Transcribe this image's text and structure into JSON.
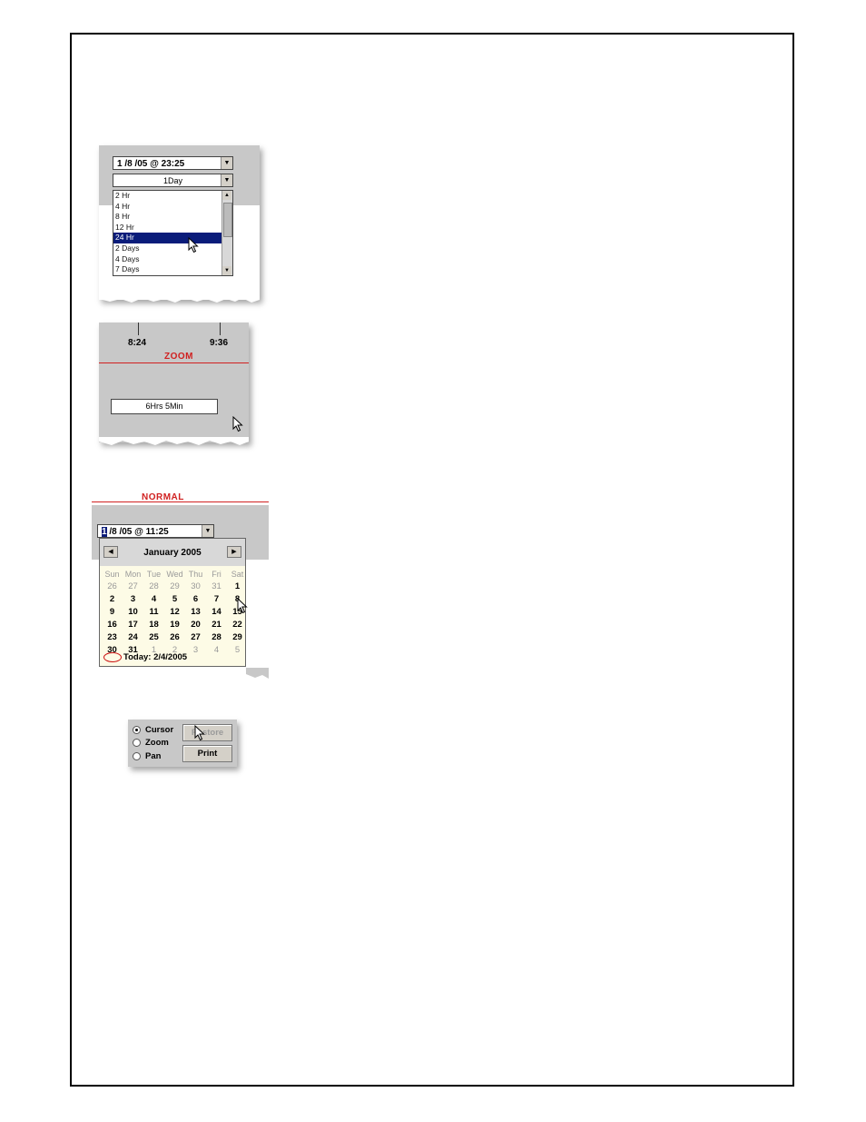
{
  "duration_picker": {
    "date_time": "1 /8 /05 @ 23:25",
    "period": "1Day",
    "options": [
      "2 Hr",
      "4 Hr",
      "8 Hr",
      "12 Hr",
      "24 Hr",
      "2 Days",
      "4 Days",
      "7 Days"
    ],
    "selected_option": "24 Hr"
  },
  "zoom_panel": {
    "tick_start": "8:24",
    "tick_end": "9:36",
    "section_label": "ZOOM",
    "span": "6Hrs 5Min"
  },
  "calendar_panel": {
    "section_label": "NORMAL",
    "date_time_cursor": "1",
    "date_time_rest": " /8 /05 @ 11:25",
    "month": "January 2005",
    "prev_icon": "chevron-left-icon",
    "next_icon": "chevron-right-icon",
    "weekdays": [
      "Sun",
      "Mon",
      "Tue",
      "Wed",
      "Thu",
      "Fri",
      "Sat"
    ],
    "weeks": [
      [
        "26",
        "27",
        "28",
        "29",
        "30",
        "31",
        "1"
      ],
      [
        "2",
        "3",
        "4",
        "5",
        "6",
        "7",
        "8"
      ],
      [
        "9",
        "10",
        "11",
        "12",
        "13",
        "14",
        "15"
      ],
      [
        "16",
        "17",
        "18",
        "19",
        "20",
        "21",
        "22"
      ],
      [
        "23",
        "24",
        "25",
        "26",
        "27",
        "28",
        "29"
      ],
      [
        "30",
        "31",
        "1",
        "2",
        "3",
        "4",
        "5"
      ]
    ],
    "today": "Today: 2/4/2005"
  },
  "mode_panel": {
    "modes": [
      "Cursor",
      "Zoom",
      "Pan"
    ],
    "selected_mode": "Cursor",
    "restore_label": "Restore",
    "print_label": "Print"
  },
  "colors": {
    "selection": "#0a1c7a",
    "section_red": "#d02020",
    "calendar_bg": "#fdfbe6"
  }
}
